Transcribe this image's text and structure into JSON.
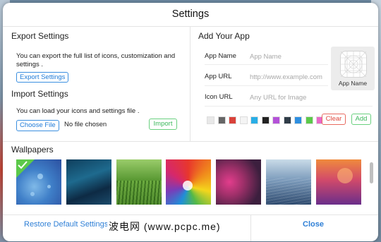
{
  "dialog": {
    "title": "Settings"
  },
  "export": {
    "heading": "Export Settings",
    "description": "You can export the full list of icons, customization and settings .",
    "button": "Export Settings"
  },
  "import": {
    "heading": "Import Settings",
    "description": "You can load your icons and settings file .",
    "choose_button": "Choose File",
    "file_status": "No file chosen",
    "import_button": "Import"
  },
  "add_app": {
    "heading": "Add Your App",
    "name_label": "App Name",
    "name_placeholder": "App Name",
    "url_label": "App URL",
    "url_placeholder": "http://www.example.com",
    "icon_url_label": "Icon URL",
    "icon_url_placeholder": "Any URL for Image",
    "preview_name": "App Name",
    "clear_button": "Clear",
    "add_button": "Add",
    "color_swatches": [
      "#e8e8e8",
      "#666666",
      "#d9423a",
      "#f4f4f4",
      "#29aee6",
      "#222222",
      "#b452d8",
      "#303c48",
      "#2e8fe0",
      "#5cc94a",
      "#e868c8"
    ]
  },
  "wallpapers": {
    "heading": "Wallpapers",
    "selected_index": 0
  },
  "footer": {
    "restore_button": "Restore Default Settings",
    "close_button": "Close"
  },
  "watermark": {
    "text": "波电网 (www.pcpc.me)"
  },
  "colors": {
    "accent_blue": "#2e7fd6",
    "accent_green": "#3cb85c",
    "accent_red": "#e0473c"
  }
}
